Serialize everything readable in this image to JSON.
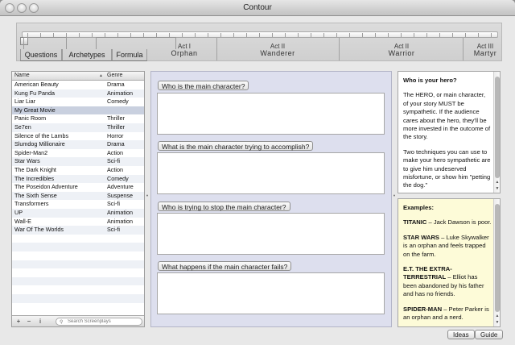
{
  "window": {
    "title": "Contour"
  },
  "tabs": [
    "Questions",
    "Archetypes",
    "Formula"
  ],
  "acts": [
    {
      "line1": "Act I",
      "line2": "Orphan"
    },
    {
      "line1": "Act II",
      "line2": "Wanderer"
    },
    {
      "line1": "Act II",
      "line2": "Warrior"
    },
    {
      "line1": "Act III",
      "line2": "Martyr"
    }
  ],
  "list": {
    "headers": {
      "name": "Name",
      "genre": "Genre"
    },
    "rows": [
      {
        "name": "American Beauty",
        "genre": "Drama"
      },
      {
        "name": "Kung Fu Panda",
        "genre": "Animation"
      },
      {
        "name": "Liar Liar",
        "genre": "Comedy"
      },
      {
        "name": "My Great Movie",
        "genre": ""
      },
      {
        "name": "Panic Room",
        "genre": "Thriller"
      },
      {
        "name": "Se7en",
        "genre": "Thriller"
      },
      {
        "name": "Silence of the Lambs",
        "genre": "Horror"
      },
      {
        "name": "Slumdog Millionaire",
        "genre": "Drama"
      },
      {
        "name": "Spider-Man2",
        "genre": "Action"
      },
      {
        "name": "Star Wars",
        "genre": "Sci-fi"
      },
      {
        "name": "The Dark Knight",
        "genre": "Action"
      },
      {
        "name": "The Incredibles",
        "genre": "Comedy"
      },
      {
        "name": "The Poseidon Adventure",
        "genre": "Adventure"
      },
      {
        "name": "The Sixth Sense",
        "genre": "Suspense"
      },
      {
        "name": "Transformers",
        "genre": "Sci-fi"
      },
      {
        "name": "UP",
        "genre": "Animation"
      },
      {
        "name": "Wall-E",
        "genre": "Animation"
      },
      {
        "name": "War Of The Worlds",
        "genre": "Sci-fi"
      }
    ],
    "selected_index": 3,
    "footer": {
      "add": "+",
      "remove": "−",
      "info": "i",
      "search_placeholder": "Search Screenplays"
    }
  },
  "questions": [
    "Who is the main character?",
    "What is the main character trying to accomplish?",
    "Who is trying to stop the main character?",
    "What happens if the main character fails?"
  ],
  "guide": {
    "title": "Who is your hero?",
    "p1": "The HERO, or main character, of your story MUST be sympathetic. If the audience cares about the hero, they'll be more invested in the outcome of the story.",
    "p2": "Two techniques you can use to make your hero sympathetic are to give him undeserved misfortune, or show him \"petting the dog.\""
  },
  "examples": {
    "title": "Examples:",
    "items": [
      {
        "head": "TITANIC",
        "text": " – Jack Dawson is poor."
      },
      {
        "head": "STAR WARS",
        "text": " – Luke Skywalker is an orphan and feels trapped on the farm."
      },
      {
        "head": "E.T. THE EXTRA-TERRESTRIAL",
        "text": " – Elliot has been abandoned by his father and has no friends."
      },
      {
        "head": "SPIDER-MAN",
        "text": " – Peter Parker is an orphan and a nerd."
      }
    ]
  },
  "buttons": {
    "ideas": "Ideas",
    "guide": "Guide"
  }
}
